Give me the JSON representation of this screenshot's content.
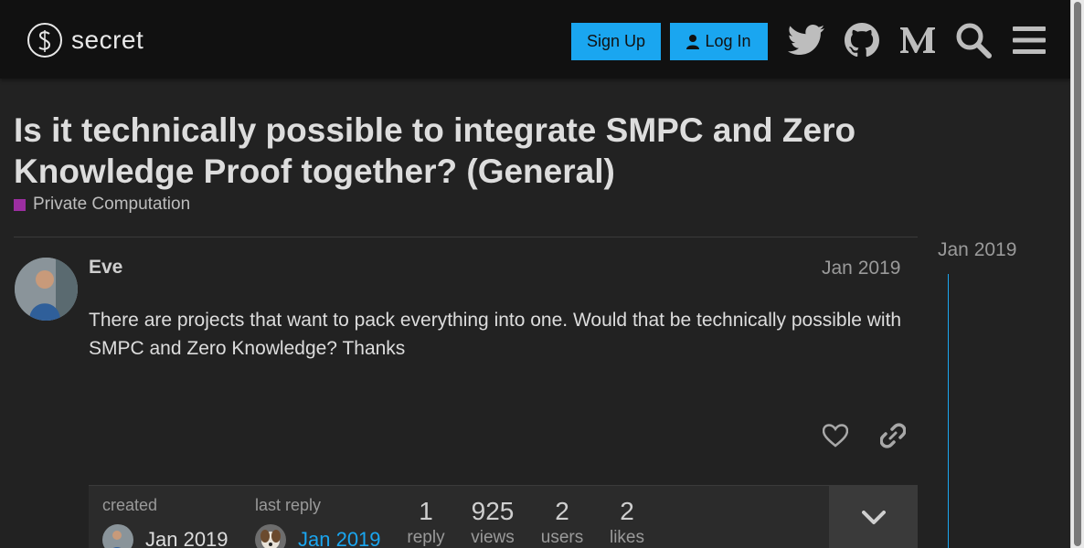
{
  "header": {
    "logo_text": "secret",
    "signup_label": "Sign Up",
    "login_label": "Log In",
    "icons": [
      "twitter-icon",
      "github-icon",
      "medium-icon",
      "search-icon",
      "hamburger-menu-icon"
    ]
  },
  "topic": {
    "title": "Is it technically possible to integrate SMPC and Zero Knowledge Proof together? (General)",
    "category": "Private Computation",
    "category_color": "#9c2ea1"
  },
  "post": {
    "author": "Eve",
    "date": "Jan 2019",
    "body": "There are projects that want to pack everything into one. Would that be technically possible with SMPC and Zero Knowledge? Thanks"
  },
  "meta": {
    "created_label": "created",
    "created_date": "Jan 2019",
    "last_reply_label": "last reply",
    "last_reply_date": "Jan 2019",
    "stats": [
      {
        "num": "1",
        "label": "reply"
      },
      {
        "num": "925",
        "label": "views"
      },
      {
        "num": "2",
        "label": "users"
      },
      {
        "num": "2",
        "label": "likes"
      }
    ]
  },
  "timeline": {
    "date": "Jan 2019"
  },
  "colors": {
    "accent": "#1aa6f0",
    "background": "#222222",
    "header": "#111111"
  }
}
